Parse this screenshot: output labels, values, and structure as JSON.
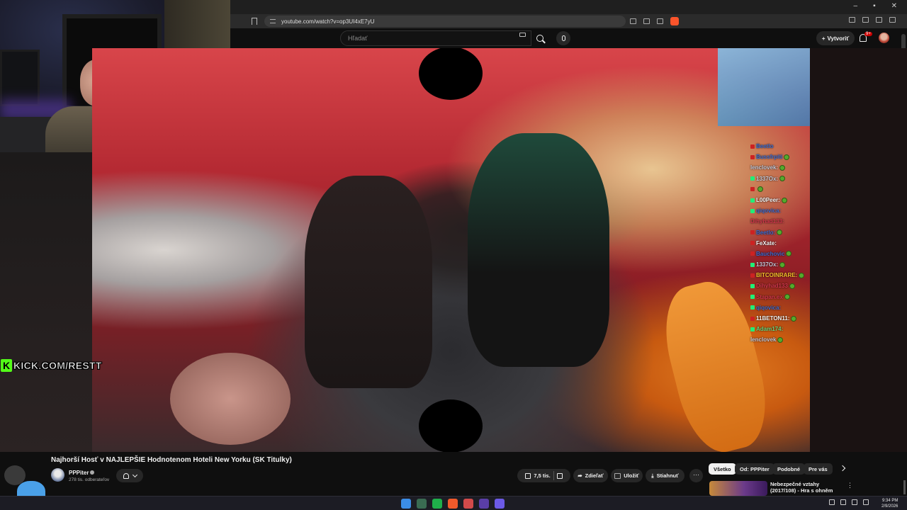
{
  "browser": {
    "url": "youtube.com/watch?v=op3UI4xE7yU",
    "window_controls": [
      "–",
      "▪",
      "✕"
    ]
  },
  "youtube": {
    "search_placeholder": "Hľadať",
    "create_label": "Vytvoriť",
    "notification_count": "9+"
  },
  "chat": [
    {
      "user": "Beetlo",
      "color": "#3a6bd1",
      "badge": "#c22",
      "check": false
    },
    {
      "user": "Bussfrpiti",
      "color": "#3a6bd1",
      "badge": "#c22",
      "check": true
    },
    {
      "user": "lenclovek:",
      "color": "#c3c7d6",
      "badge": "",
      "check": true
    },
    {
      "user": "1337Ox:",
      "color": "#c3c7d6",
      "badge": "#2e7",
      "check": true
    },
    {
      "user": "",
      "color": "#c3c7d6",
      "badge": "#c22",
      "check": true
    },
    {
      "user": "L00Peer:",
      "color": "#f2f2f2",
      "badge": "#2e7",
      "check": true
    },
    {
      "user": "qiqovica:",
      "color": "#3a6bd1",
      "badge": "#2e7",
      "check": false
    },
    {
      "user": "Dihyhad133:",
      "color": "#d2364b",
      "badge": "",
      "check": false
    },
    {
      "user": "Beetlo:",
      "color": "#3a6bd1",
      "badge": "#c22",
      "check": true
    },
    {
      "user": "FeXate:",
      "color": "#f2f2f2",
      "badge": "#c22",
      "check": false
    },
    {
      "user": "Bauchovic",
      "color": "#3a6bd1",
      "badge": "#c22",
      "check": true
    },
    {
      "user": "1337Ox:",
      "color": "#c3c7d6",
      "badge": "#2e7",
      "check": true
    },
    {
      "user": "BITCOINRARE:",
      "color": "#f0c028",
      "badge": "#c22",
      "check": true
    },
    {
      "user": "Dihyhad133",
      "color": "#d2364b",
      "badge": "#2e7",
      "check": true
    },
    {
      "user": "Stapan.ex",
      "color": "#d2364b",
      "badge": "#2e7",
      "check": true
    },
    {
      "user": "qiqovica:",
      "color": "#3a6bd1",
      "badge": "#2e7",
      "check": false
    },
    {
      "user": "11BETON11:",
      "color": "#f2f2f2",
      "badge": "#c22",
      "check": true
    },
    {
      "user": "Adam174:",
      "color": "#6bd17a",
      "badge": "#2e7",
      "check": false
    },
    {
      "user": "lenclovek",
      "color": "#c3c7d6",
      "badge": "",
      "check": true
    }
  ],
  "watermark": {
    "logo": "K",
    "text": "KICK.COM/RESTT"
  },
  "video": {
    "title": "Najhorší Hosť v NAJLEPŠIE Hodnotenom Hoteli New Yorku (SK Titulky)",
    "channel": "PPPiter",
    "subscribers": "278 tis. odberateľov",
    "likes": "7,5 tis.",
    "share_label": "Zdieľať",
    "save_label": "Uložiť",
    "download_label": "Stiahnuť",
    "more_label": "···"
  },
  "chips": [
    "Všetko",
    "Od: PPPiter",
    "Podobné",
    "Pre vás"
  ],
  "recommendation": {
    "title": "Nebezpečné vztahy (2017/108) - Hra s ohněm",
    "menu": "⋮"
  },
  "taskbar": {
    "time": "9:34 PM",
    "date": "2/9/2026",
    "app_colors": [
      "#3b8de6",
      "#3a6b52",
      "#1fae4a",
      "#f25a2b",
      "#d34a4a",
      "#5a3ea8",
      "#6c5ae6"
    ]
  }
}
